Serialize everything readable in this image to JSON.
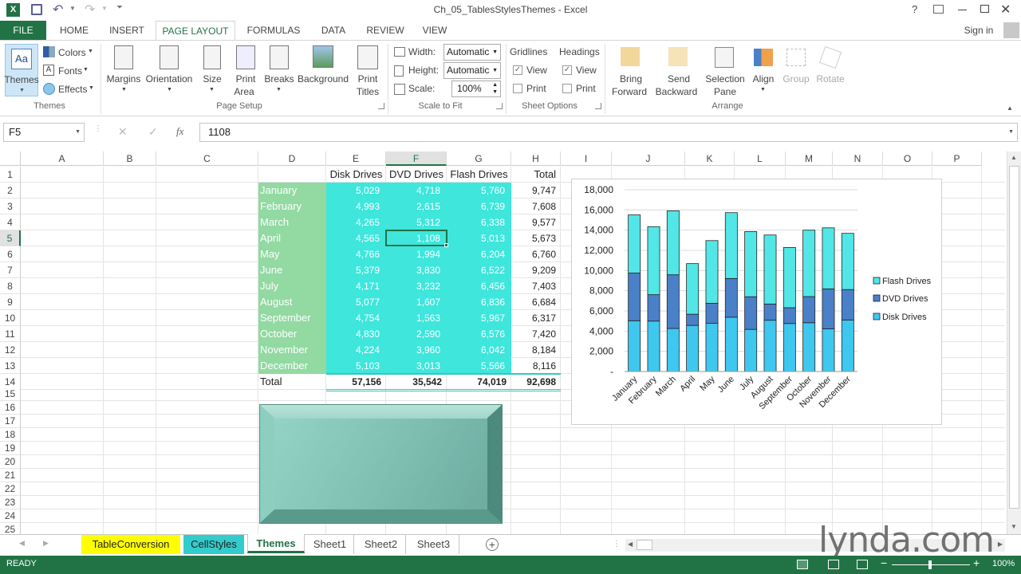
{
  "app": {
    "title": "Ch_05_TablesStylesThemes - Excel",
    "signin": "Sign in"
  },
  "colors": {
    "excel_green": "#217346",
    "month_fill": "#92d9a2",
    "data_fill": "#3ee6dc",
    "flash": "#52e6e6",
    "dvd": "#4a80c8",
    "disk": "#3ec8f0",
    "tab_yellow": "#ffff00",
    "tab_cyan": "#33cccc"
  },
  "ribbon_tabs": [
    "FILE",
    "HOME",
    "INSERT",
    "PAGE LAYOUT",
    "FORMULAS",
    "DATA",
    "REVIEW",
    "VIEW"
  ],
  "ribbon": {
    "themes_label": "Themes",
    "colors_label": "Colors",
    "fonts_label": "Fonts",
    "effects_label": "Effects",
    "margins": "Margins",
    "orientation": "Orientation",
    "size": "Size",
    "print_area_1": "Print",
    "print_area_2": "Area",
    "breaks": "Breaks",
    "background": "Background",
    "print_titles_1": "Print",
    "print_titles_2": "Titles",
    "width_label": "Width:",
    "width_value": "Automatic",
    "height_label": "Height:",
    "height_value": "Automatic",
    "scale_label": "Scale:",
    "scale_value": "100%",
    "gridlines": "Gridlines",
    "headings": "Headings",
    "view": "View",
    "print": "Print",
    "bring_1": "Bring",
    "bring_2": "Forward",
    "send_1": "Send",
    "send_2": "Backward",
    "selection_1": "Selection",
    "selection_2": "Pane",
    "align": "Align",
    "group": "Group",
    "rotate": "Rotate",
    "groups": {
      "themes": "Themes",
      "page_setup": "Page Setup",
      "scale_to_fit": "Scale to Fit",
      "sheet_options": "Sheet Options",
      "arrange": "Arrange"
    }
  },
  "formula_bar": {
    "name_box": "F5",
    "fx": "fx",
    "value": "1108"
  },
  "columns": [
    "A",
    "B",
    "C",
    "D",
    "E",
    "F",
    "G",
    "H",
    "I",
    "J",
    "K",
    "L",
    "M",
    "N",
    "O",
    "P"
  ],
  "rows": [
    "1",
    "2",
    "3",
    "4",
    "5",
    "6",
    "7",
    "8",
    "9",
    "10",
    "11",
    "12",
    "13",
    "14",
    "15",
    "16",
    "17",
    "18",
    "19",
    "20",
    "21",
    "22",
    "23",
    "24",
    "25"
  ],
  "table": {
    "headers": [
      "Disk Drives",
      "DVD Drives",
      "Flash Drives",
      "Total"
    ],
    "months": [
      "January",
      "February",
      "March",
      "April",
      "May",
      "June",
      "July",
      "August",
      "September",
      "October",
      "November",
      "December"
    ],
    "disk": [
      "5,029",
      "4,993",
      "4,265",
      "4,565",
      "4,766",
      "5,379",
      "4,171",
      "5,077",
      "4,754",
      "4,830",
      "4,224",
      "5,103"
    ],
    "dvd": [
      "4,718",
      "2,615",
      "5,312",
      "1,108",
      "1,994",
      "3,830",
      "3,232",
      "1,607",
      "1,563",
      "2,590",
      "3,960",
      "3,013"
    ],
    "flash": [
      "5,760",
      "6,739",
      "6,338",
      "5,013",
      "6,204",
      "6,522",
      "6,456",
      "6,836",
      "5,967",
      "6,576",
      "6,042",
      "5,566"
    ],
    "total": [
      "9,747",
      "7,608",
      "9,577",
      "5,673",
      "6,760",
      "9,209",
      "7,403",
      "6,684",
      "6,317",
      "7,420",
      "8,184",
      "8,116"
    ],
    "total_label": "Total",
    "grand": [
      "57,156",
      "35,542",
      "74,019",
      "92,698"
    ]
  },
  "chart_data": {
    "type": "bar",
    "stacked": true,
    "categories": [
      "January",
      "February",
      "March",
      "April",
      "May",
      "June",
      "July",
      "August",
      "September",
      "October",
      "November",
      "December"
    ],
    "series": [
      {
        "name": "Disk Drives",
        "values": [
          5029,
          4993,
          4265,
          4565,
          4766,
          5379,
          4171,
          5077,
          4754,
          4830,
          4224,
          5103
        ]
      },
      {
        "name": "DVD Drives",
        "values": [
          4718,
          2615,
          5312,
          1108,
          1994,
          3830,
          3232,
          1607,
          1563,
          2590,
          3960,
          3013
        ]
      },
      {
        "name": "Flash Drives",
        "values": [
          5760,
          6739,
          6338,
          5013,
          6204,
          6522,
          6456,
          6836,
          5967,
          6576,
          6042,
          5566
        ]
      }
    ],
    "ylim": [
      0,
      18000
    ],
    "yticks": [
      "-",
      "2,000",
      "4,000",
      "6,000",
      "8,000",
      "10,000",
      "12,000",
      "14,000",
      "16,000",
      "18,000"
    ],
    "legend": [
      "Flash Drives",
      "DVD Drives",
      "Disk Drives"
    ],
    "legend_position": "right",
    "grid": true
  },
  "sheet_tabs": [
    "TableConversion",
    "CellStyles",
    "Themes",
    "Sheet1",
    "Sheet2",
    "Sheet3"
  ],
  "status": {
    "ready": "READY",
    "zoom": "100%"
  },
  "watermark": "lynda.com"
}
